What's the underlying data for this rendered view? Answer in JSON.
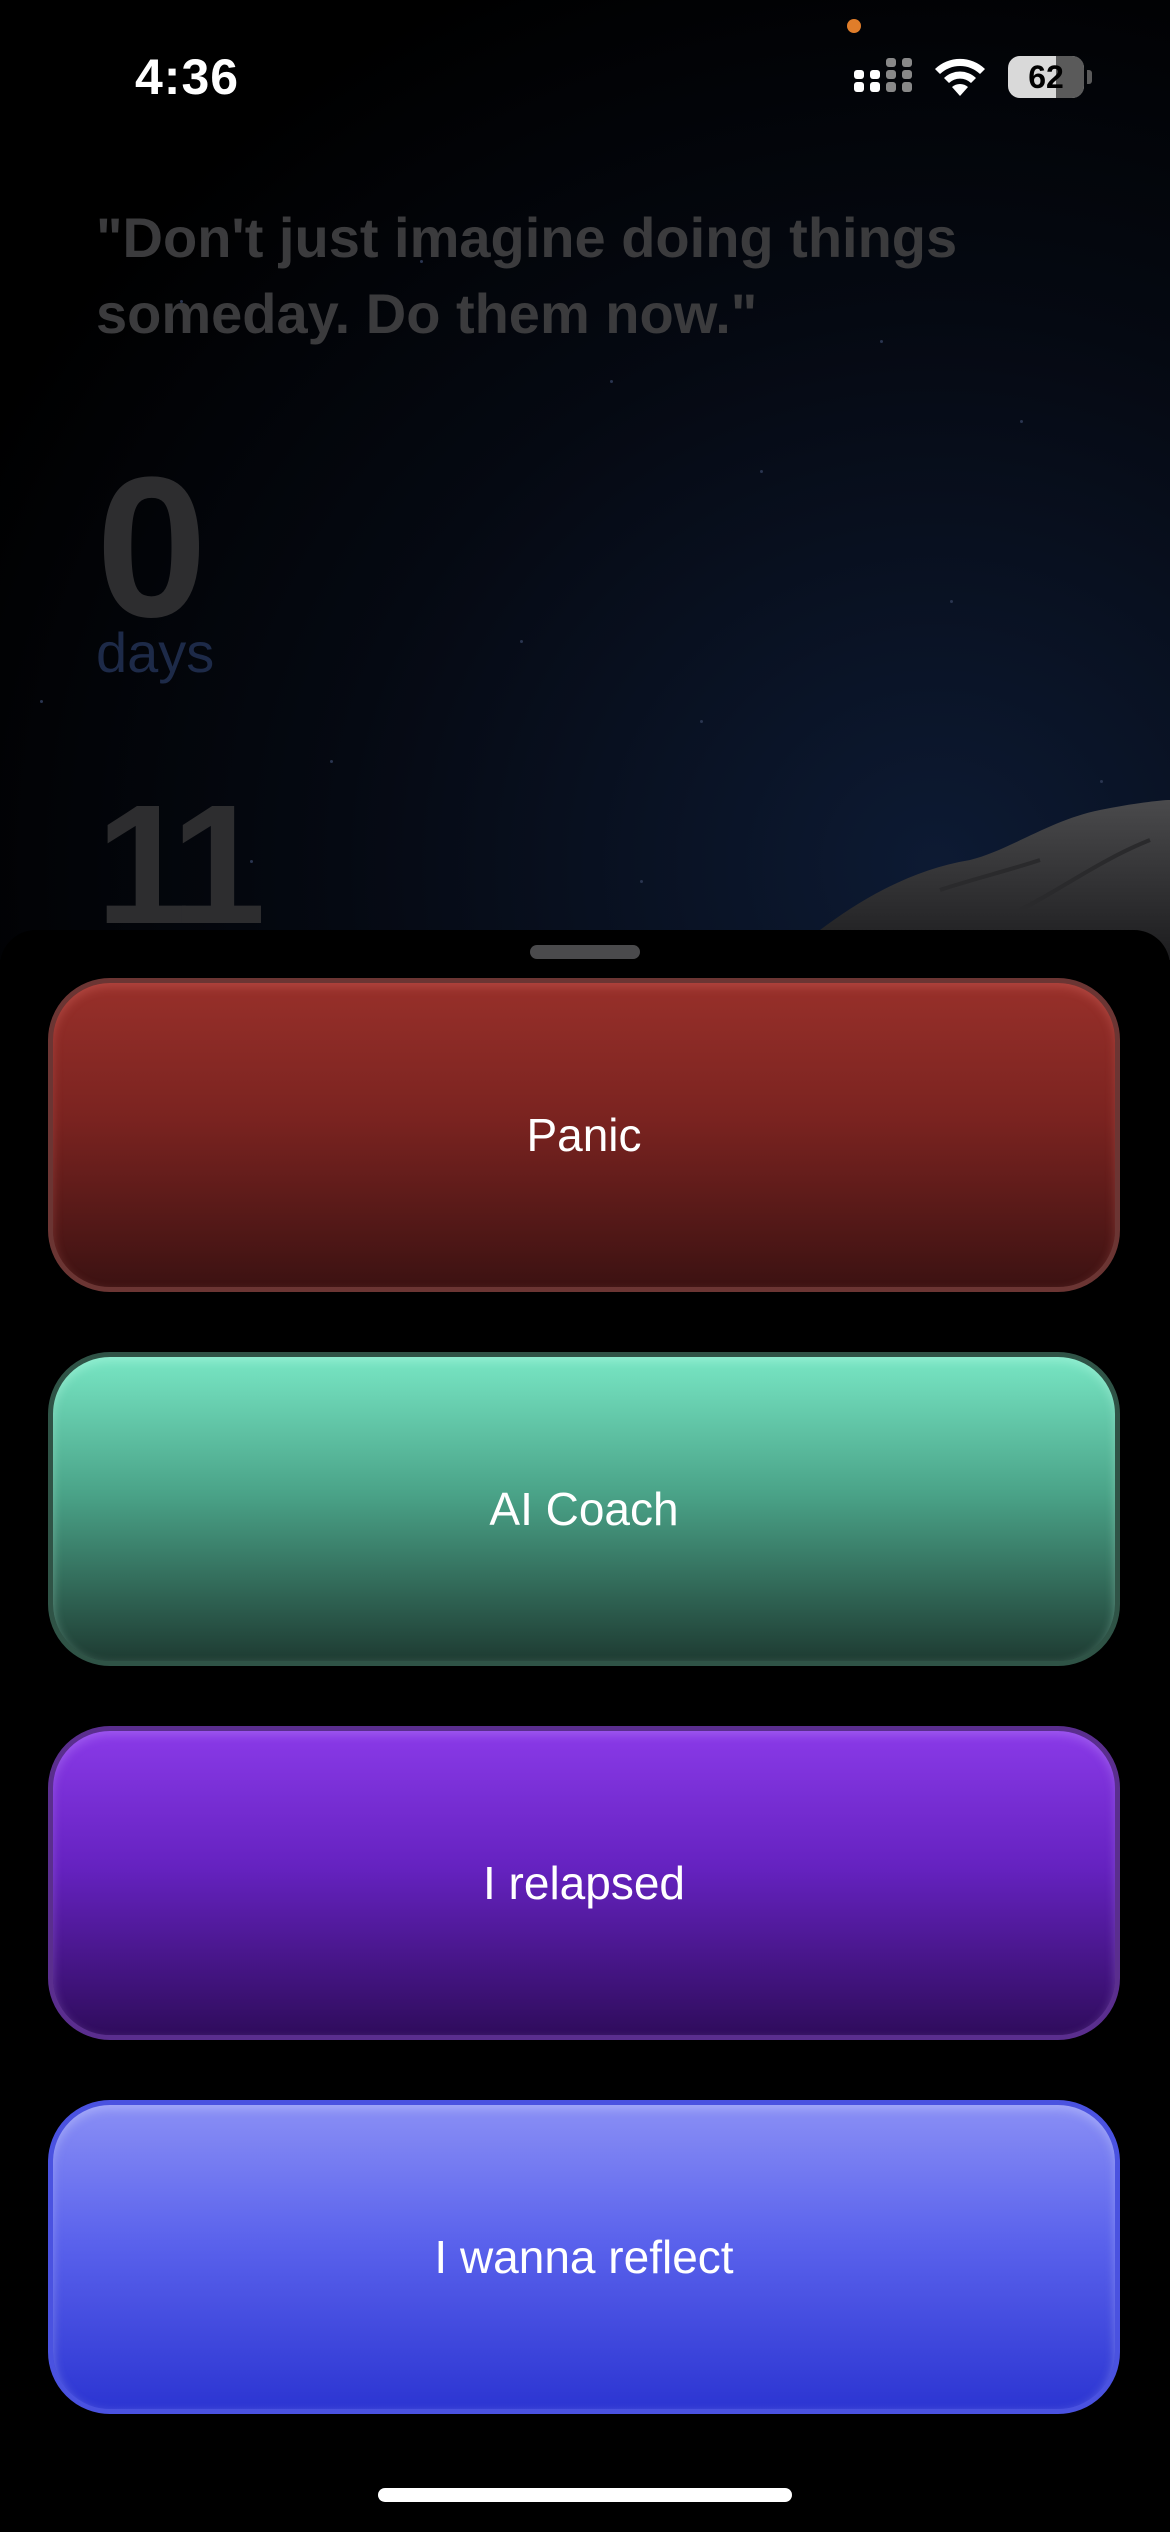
{
  "status_bar": {
    "time": "4:36",
    "battery_level": "62",
    "icons": [
      "signal-icon",
      "wifi-icon",
      "battery-icon"
    ]
  },
  "background": {
    "quote": "\"Don't just imagine doing things someday. Do them now.\"",
    "streak_days_value": "0",
    "streak_days_label": "days",
    "streak_second_value": "11"
  },
  "sheet": {
    "actions": [
      {
        "label": "Panic",
        "color": "#7a2320"
      },
      {
        "label": "AI Coach",
        "color": "#4aa388"
      },
      {
        "label": "I relapsed",
        "color": "#6522c0"
      },
      {
        "label": "I wanna reflect",
        "color": "#5a62ec"
      }
    ]
  }
}
